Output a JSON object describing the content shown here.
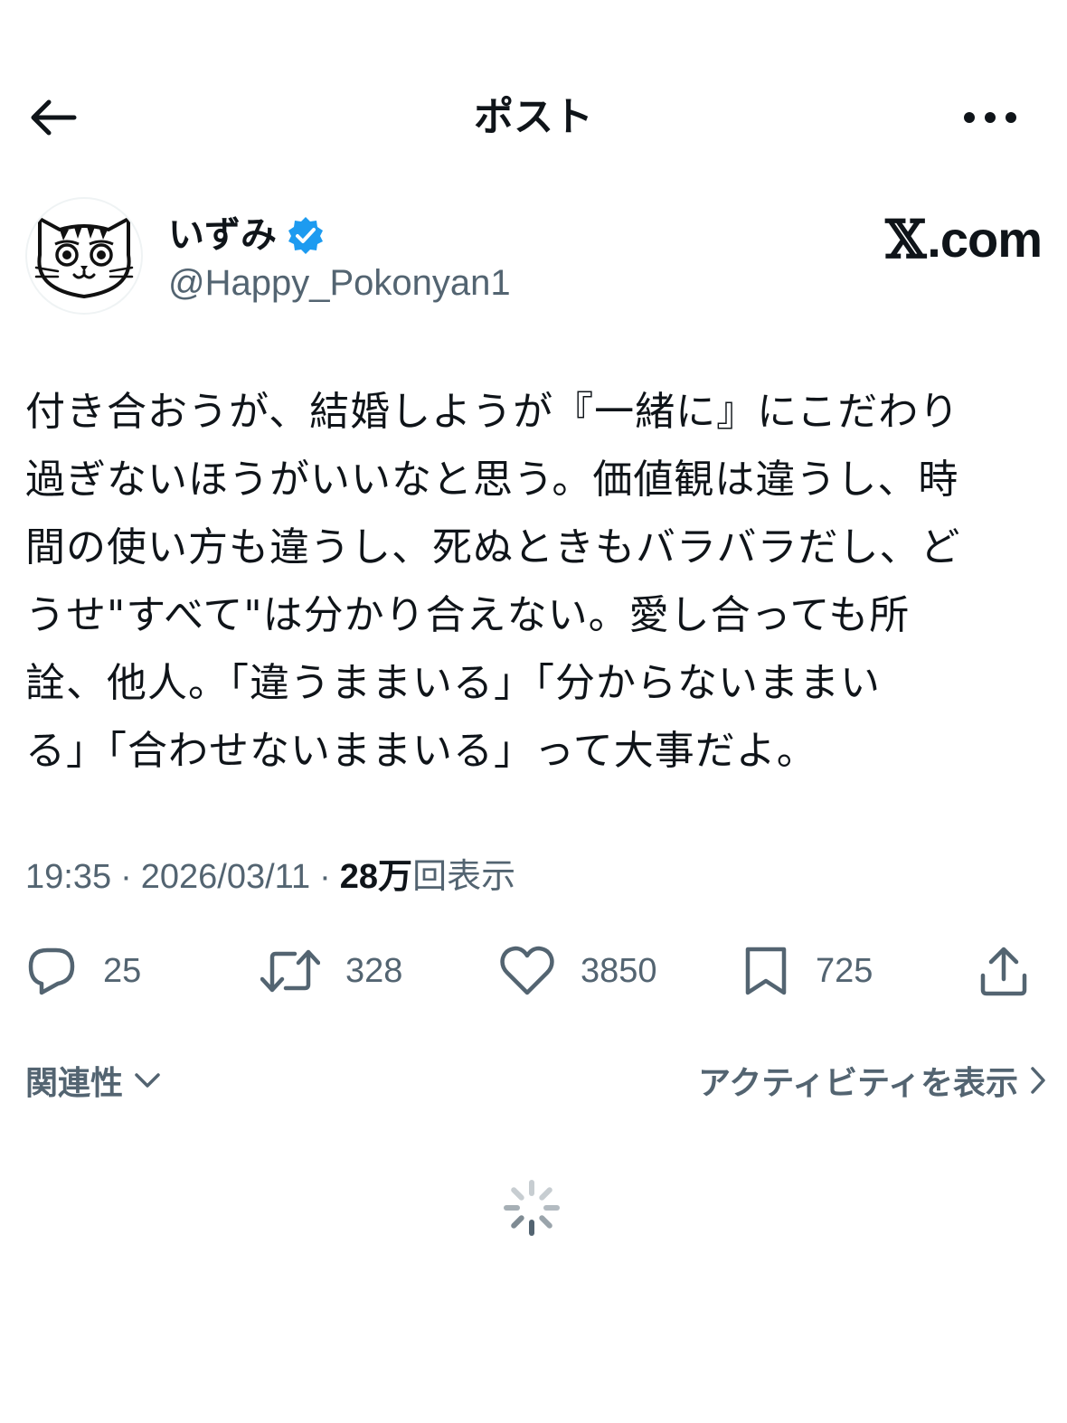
{
  "header": {
    "title": "ポスト",
    "back_icon": "arrow-left-icon",
    "more_icon": "more-horizontal-icon"
  },
  "author": {
    "display_name": "いずみ",
    "handle": "@Happy_Pokonyan1",
    "verified_color": "#1d9bf0",
    "avatar_icon": "cat-face-avatar"
  },
  "watermark": {
    "x_letter": "𝕏",
    "rest": ".com"
  },
  "tweet": {
    "text": "付き合おうが、結婚しようが『一緒に』にこだわり\n過ぎないほうがいいなと思う。価値観は違うし、時\n間の使い方も違うし、死ぬときもバラバラだし、ど\nうせ\"すべて\"は分かり合えない。愛し合っても所\n詮、他人。「違うままいる」「分からないままい\nる」「合わせないままいる」って大事だよ。"
  },
  "meta": {
    "time": "19:35",
    "date": "2026/03/11",
    "separator": "·",
    "views_count": "28万",
    "views_label": "回表示"
  },
  "actions": {
    "reply": {
      "icon": "reply-icon",
      "count": "25"
    },
    "repost": {
      "icon": "repost-icon",
      "count": "328"
    },
    "like": {
      "icon": "heart-icon",
      "count": "3850"
    },
    "bookmark": {
      "icon": "bookmark-icon",
      "count": "725"
    },
    "share": {
      "icon": "share-icon"
    }
  },
  "footer": {
    "relevance_label": "関連性",
    "activity_label": "アクティビティを表示"
  },
  "colors": {
    "text": "#0f1419",
    "secondary": "#536471",
    "verified": "#1d9bf0"
  }
}
